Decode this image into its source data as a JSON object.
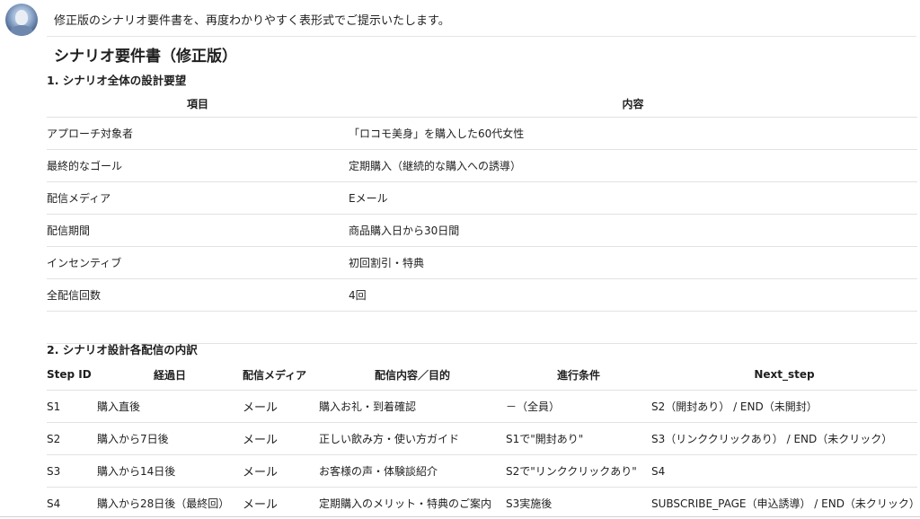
{
  "message": {
    "intro": "修正版のシナリオ要件書を、再度わかりやすく表形式でご提示いたします。"
  },
  "document": {
    "title": "シナリオ要件書（修正版）",
    "section1": {
      "title": "1. シナリオ全体の設計要望",
      "headers": [
        "項目",
        "内容"
      ],
      "rows": [
        [
          "アプローチ対象者",
          "「ロコモ美身」を購入した60代女性"
        ],
        [
          "最終的なゴール",
          "定期購入（継続的な購入への誘導）"
        ],
        [
          "配信メディア",
          "Eメール"
        ],
        [
          "配信期間",
          "商品購入日から30日間"
        ],
        [
          "インセンティブ",
          "初回割引・特典"
        ],
        [
          "全配信回数",
          "4回"
        ]
      ]
    },
    "section2": {
      "title": "2. シナリオ設計各配信の内訳",
      "headers": [
        "Step ID",
        "経過日",
        "配信メディア",
        "配信内容／目的",
        "進行条件",
        "Next_step"
      ],
      "rows": [
        [
          "S1",
          "購入直後",
          "メール",
          "購入お礼・到着確認",
          "－（全員）",
          "S2（開封あり） / END（未開封）"
        ],
        [
          "S2",
          "購入から7日後",
          "メール",
          "正しい飲み方・使い方ガイド",
          "S1で\"開封あり\"",
          "S3（リンククリックあり） / END（未クリック）"
        ],
        [
          "S3",
          "購入から14日後",
          "メール",
          "お客様の声・体験談紹介",
          "S2で\"リンククリックあり\"",
          "S4"
        ],
        [
          "S4",
          "購入から28日後（最終回）",
          "メール",
          "定期購入のメリット・特典のご案内",
          "S3実施後",
          "SUBSCRIBE_PAGE（申込誘導） / END（未クリック）"
        ]
      ]
    }
  }
}
